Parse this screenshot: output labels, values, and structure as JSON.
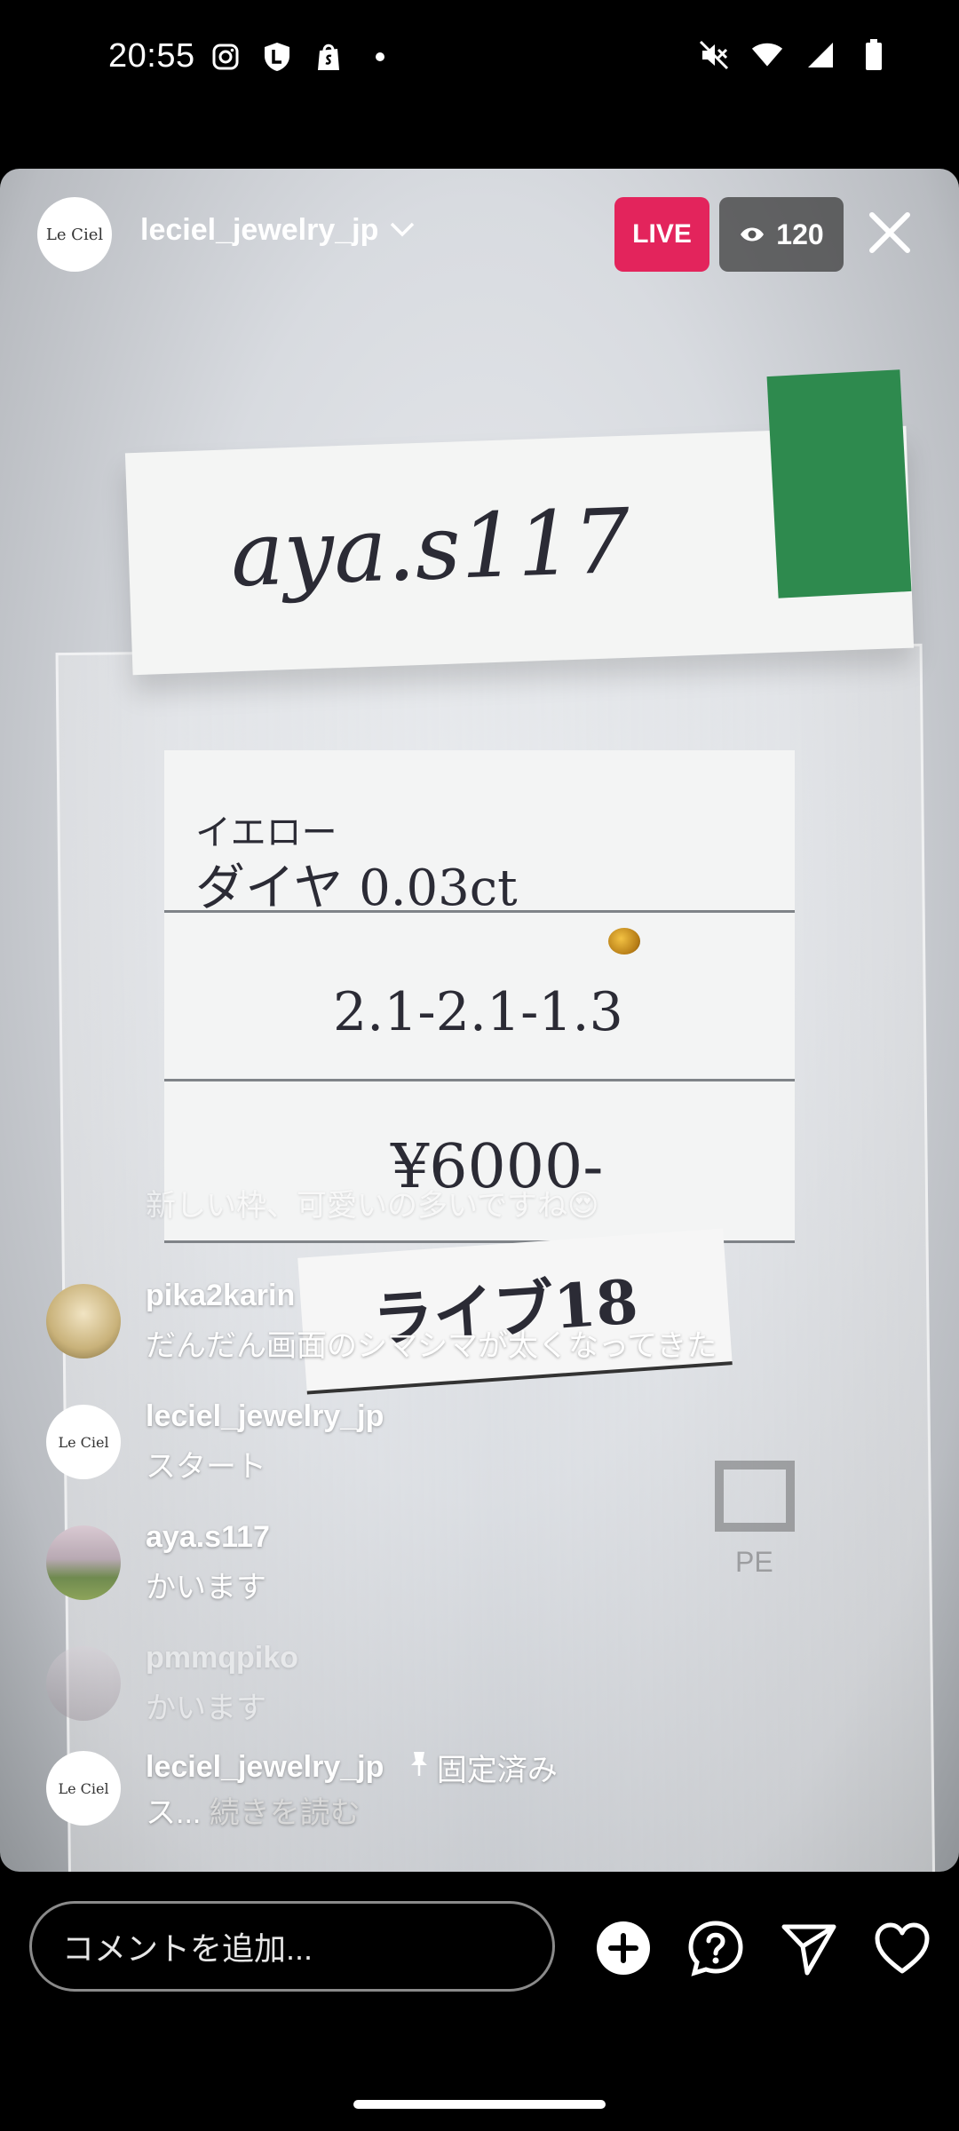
{
  "status_bar": {
    "time": "20:55",
    "left_icons": [
      "instagram-icon",
      "shield-l-icon",
      "shopify-bag-icon",
      "dot-icon"
    ],
    "right_icons": [
      "mute-icon",
      "wifi-icon",
      "signal-icon",
      "battery-icon"
    ]
  },
  "live": {
    "username": "leciel_jewelry_jp",
    "avatar_text": "Le Ciel",
    "live_label": "LIVE",
    "viewer_count": "120"
  },
  "scene_text": {
    "tag_name": "aya.s117",
    "desc_line1": "イエロー",
    "desc_line2": "ダイヤ 0.03ct",
    "size": "2.1-2.1-1.3",
    "price": "¥6000-",
    "live_label": "ライブ18",
    "recycle_label": "PE"
  },
  "comments": [
    {
      "user": "",
      "text": "新しい枠、可愛いの多いですね😍",
      "faded": true
    },
    {
      "user": "pika2karin",
      "text": "だんだん画面のシマシマが太くなってきた"
    },
    {
      "user": "leciel_jewelry_jp",
      "text": "スタート"
    },
    {
      "user": "aya.s117",
      "text": "かいます"
    },
    {
      "user": "pmmqpiko",
      "text": "かいます",
      "faded": true
    }
  ],
  "pinned": {
    "user": "leciel_jewelry_jp",
    "pin_label": "固定済み",
    "text": "ス...",
    "read_more": "続きを読む"
  },
  "bottom_bar": {
    "comment_placeholder": "コメントを追加...",
    "icons": [
      "add-icon",
      "question-icon",
      "send-icon",
      "heart-icon"
    ]
  },
  "colors": {
    "live_badge": "#e3245c",
    "background": "#000000"
  }
}
